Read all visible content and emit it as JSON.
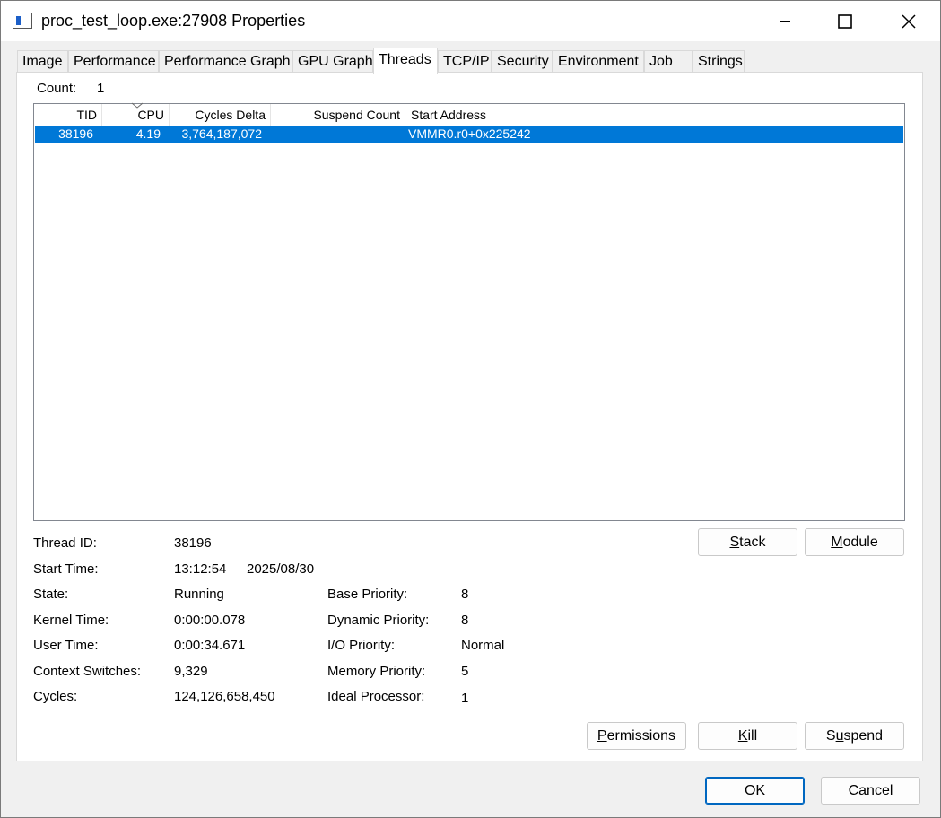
{
  "window": {
    "title": "proc_test_loop.exe:27908 Properties",
    "accent": "#0078d7"
  },
  "tabs": [
    {
      "label": "Image"
    },
    {
      "label": "Performance"
    },
    {
      "label": "Performance Graph"
    },
    {
      "label": "GPU Graph"
    },
    {
      "label": "Threads",
      "active": true
    },
    {
      "label": "TCP/IP"
    },
    {
      "label": "Security"
    },
    {
      "label": "Environment"
    },
    {
      "label": "Job"
    },
    {
      "label": "Strings"
    }
  ],
  "threads": {
    "count_label": "Count:",
    "count_value": "1",
    "columns": [
      "TID",
      "CPU",
      "Cycles Delta",
      "Suspend Count",
      "Start Address"
    ],
    "sorted_column": "CPU",
    "rows": [
      {
        "tid": "38196",
        "cpu": "4.19",
        "cycles_delta": "3,764,187,072",
        "suspend_count": "",
        "start_address": "VMMR0.r0+0x225242",
        "selected": true
      }
    ]
  },
  "details": {
    "thread_id_label": "Thread ID:",
    "thread_id": "38196",
    "start_time_label": "Start Time:",
    "start_time": "13:12:54",
    "start_date": "2025/08/30",
    "state_label": "State:",
    "state": "Running",
    "kernel_time_label": "Kernel Time:",
    "kernel_time": "0:00:00.078",
    "user_time_label": "User Time:",
    "user_time": "0:00:34.671",
    "context_switches_label": "Context Switches:",
    "context_switches": "9,329",
    "cycles_label": "Cycles:",
    "cycles": "124,126,658,450",
    "base_priority_label": "Base Priority:",
    "base_priority": "8",
    "dynamic_priority_label": "Dynamic Priority:",
    "dynamic_priority": "8",
    "io_priority_label": "I/O Priority:",
    "io_priority": "Normal",
    "memory_priority_label": "Memory Priority:",
    "memory_priority": "5",
    "ideal_processor_label": "Ideal Processor:",
    "ideal_processor": "1"
  },
  "buttons": {
    "stack": {
      "accel": "S",
      "rest": "tack"
    },
    "module": {
      "accel": "M",
      "rest": "odule"
    },
    "permissions": {
      "accel": "P",
      "rest": "ermissions"
    },
    "kill": {
      "accel": "K",
      "rest": "ill"
    },
    "suspend": {
      "pre": "S",
      "accel": "u",
      "rest": "spend"
    },
    "ok": {
      "accel": "O",
      "rest": "K"
    },
    "cancel": {
      "accel": "C",
      "rest": "ancel"
    }
  }
}
